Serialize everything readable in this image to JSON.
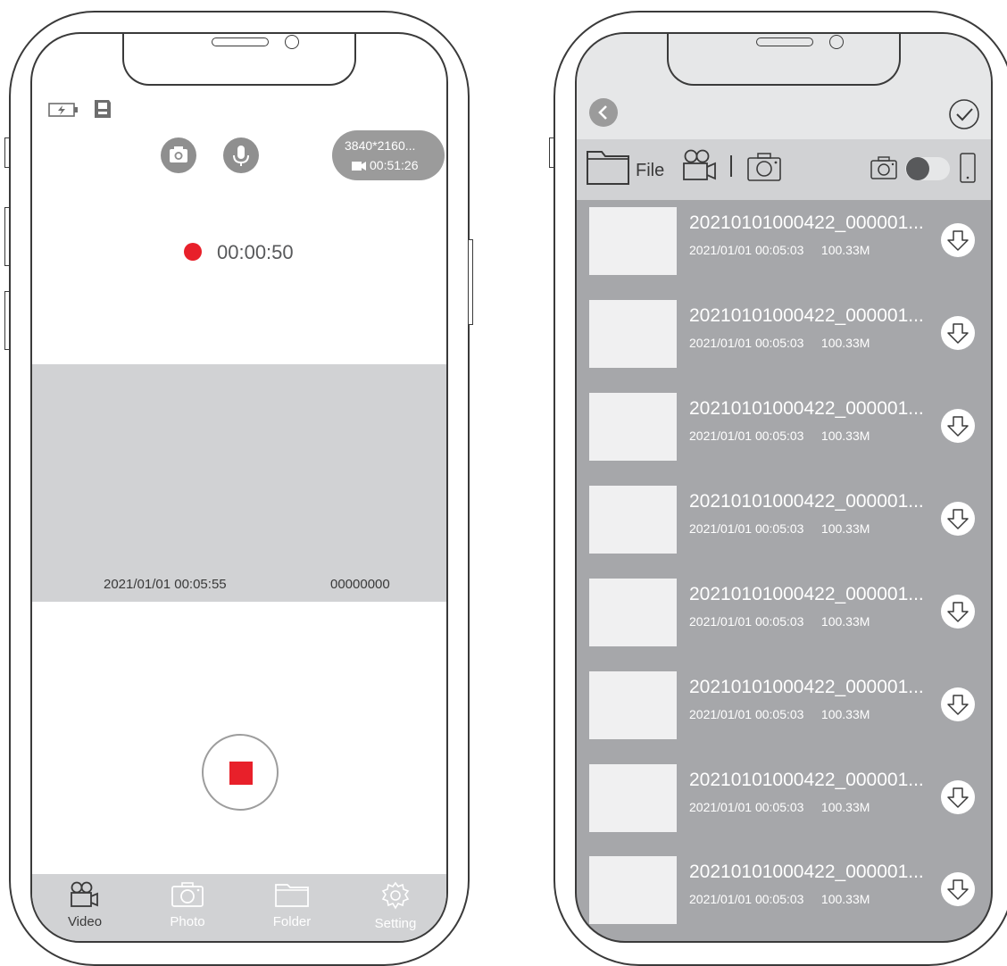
{
  "left_phone": {
    "status_icons": [
      "battery-charging-icon",
      "sd-card-icon"
    ],
    "quick_actions": [
      "camera-icon",
      "microphone-icon"
    ],
    "resolution_badge": {
      "resolution": "3840*2160...",
      "remaining_time": "00:51:26",
      "icon": "video-camera-icon"
    },
    "recording": {
      "indicator_color": "#e8202a",
      "elapsed": "00:00:50"
    },
    "preview": {
      "timestamp": "2021/01/01 00:05:55",
      "counter": "00000000"
    },
    "stop_button": {
      "color": "#e8202a"
    },
    "tabs": [
      {
        "label": "Video",
        "icon": "video-camera-icon",
        "active": true
      },
      {
        "label": "Photo",
        "icon": "camera-icon",
        "active": false
      },
      {
        "label": "Folder",
        "icon": "folder-icon",
        "active": false
      },
      {
        "label": "Setting",
        "icon": "gear-icon",
        "active": false
      }
    ]
  },
  "right_phone": {
    "header": {
      "back_icon": "chevron-left-icon",
      "confirm_icon": "check-circle-icon"
    },
    "toolbar": {
      "file_label": "File",
      "left_icons": [
        "folder-icon",
        "video-camera-icon",
        "camera-icon"
      ],
      "right_icons": [
        "camera-icon",
        "toggle-switch",
        "phone-icon"
      ]
    },
    "files": [
      {
        "name": "20210101000422_000001...",
        "date": "2021/01/01 00:05:03",
        "size": "100.33M"
      },
      {
        "name": "20210101000422_000001...",
        "date": "2021/01/01 00:05:03",
        "size": "100.33M"
      },
      {
        "name": "20210101000422_000001...",
        "date": "2021/01/01 00:05:03",
        "size": "100.33M"
      },
      {
        "name": "20210101000422_000001...",
        "date": "2021/01/01 00:05:03",
        "size": "100.33M"
      },
      {
        "name": "20210101000422_000001...",
        "date": "2021/01/01 00:05:03",
        "size": "100.33M"
      },
      {
        "name": "20210101000422_000001...",
        "date": "2021/01/01 00:05:03",
        "size": "100.33M"
      },
      {
        "name": "20210101000422_000001...",
        "date": "2021/01/01 00:05:03",
        "size": "100.33M"
      },
      {
        "name": "20210101000422_000001...",
        "date": "2021/01/01 00:05:03",
        "size": "100.33M"
      }
    ]
  },
  "colors": {
    "outline": "#3a3a3a",
    "gray_panel": "#d1d2d4",
    "list_bg": "#a6a7aa",
    "header_bg": "#e6e7e8",
    "accent_red": "#e8202a"
  }
}
